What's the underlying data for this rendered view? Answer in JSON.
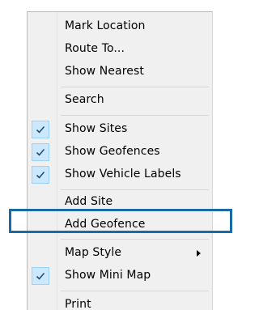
{
  "menu": {
    "items": [
      {
        "label": "Mark Location",
        "checked": false,
        "has_submenu": false
      },
      {
        "label": "Route To...",
        "checked": false,
        "has_submenu": false
      },
      {
        "label": "Show Nearest",
        "checked": false,
        "has_submenu": false
      },
      {
        "label": "Search",
        "checked": false,
        "has_submenu": false
      },
      {
        "label": "Show Sites",
        "checked": true,
        "has_submenu": false
      },
      {
        "label": "Show Geofences",
        "checked": true,
        "has_submenu": false
      },
      {
        "label": "Show Vehicle Labels",
        "checked": true,
        "has_submenu": false
      },
      {
        "label": "Add Site",
        "checked": false,
        "has_submenu": false
      },
      {
        "label": "Add Geofence",
        "checked": false,
        "has_submenu": false,
        "highlighted": true
      },
      {
        "label": "Map Style",
        "checked": false,
        "has_submenu": true
      },
      {
        "label": "Show Mini Map",
        "checked": true,
        "has_submenu": false
      },
      {
        "label": "Print",
        "checked": false,
        "has_submenu": false
      }
    ]
  },
  "colors": {
    "menu_bg": "#f0f0f0",
    "check_bg": "#cce8ff",
    "check_border": "#99d1ff",
    "check_mark": "#1f4e79",
    "highlight_border": "#1a6aa8"
  },
  "icons": {
    "check": "check-icon",
    "submenu": "chevron-right-icon"
  }
}
